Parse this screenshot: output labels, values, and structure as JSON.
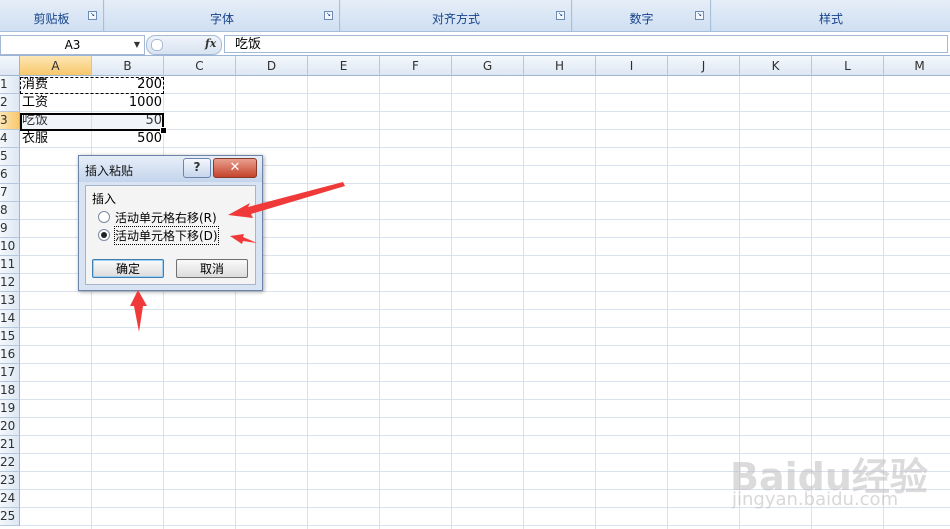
{
  "ribbon": {
    "groups": [
      {
        "label": "剪贴板"
      },
      {
        "label": "字体"
      },
      {
        "label": "对齐方式"
      },
      {
        "label": "数字"
      },
      {
        "label": "样式"
      }
    ]
  },
  "formula_bar": {
    "name_box": "A3",
    "fx_label": "fx",
    "content": "吃饭"
  },
  "sheet": {
    "columns": [
      "A",
      "B",
      "C",
      "D",
      "E",
      "F",
      "G",
      "H",
      "I",
      "J",
      "K",
      "L",
      "M"
    ],
    "rows": [
      "1",
      "2",
      "3",
      "4",
      "5",
      "6",
      "7",
      "8",
      "9",
      "10",
      "11",
      "12",
      "13",
      "14",
      "15",
      "16",
      "17",
      "18",
      "19",
      "20",
      "21",
      "22",
      "23",
      "24",
      "25"
    ],
    "data": [
      {
        "a": "消费",
        "b": "200"
      },
      {
        "a": "工资",
        "b": "1000"
      },
      {
        "a": "吃饭",
        "b": "50"
      },
      {
        "a": "衣服",
        "b": "500"
      }
    ]
  },
  "dialog": {
    "title": "插入粘贴",
    "help": "?",
    "close": "✕",
    "group_label": "插入",
    "option_right": "活动单元格右移(R)",
    "option_down": "活动单元格下移(D)",
    "selected_option": "down",
    "ok": "确定",
    "cancel": "取消"
  },
  "watermark": {
    "brand": "Baidu经验",
    "url": "jingyan.baidu.com"
  },
  "colors": {
    "annotation_arrow": "#f03a3a",
    "selected_header": "#f8c76c"
  }
}
